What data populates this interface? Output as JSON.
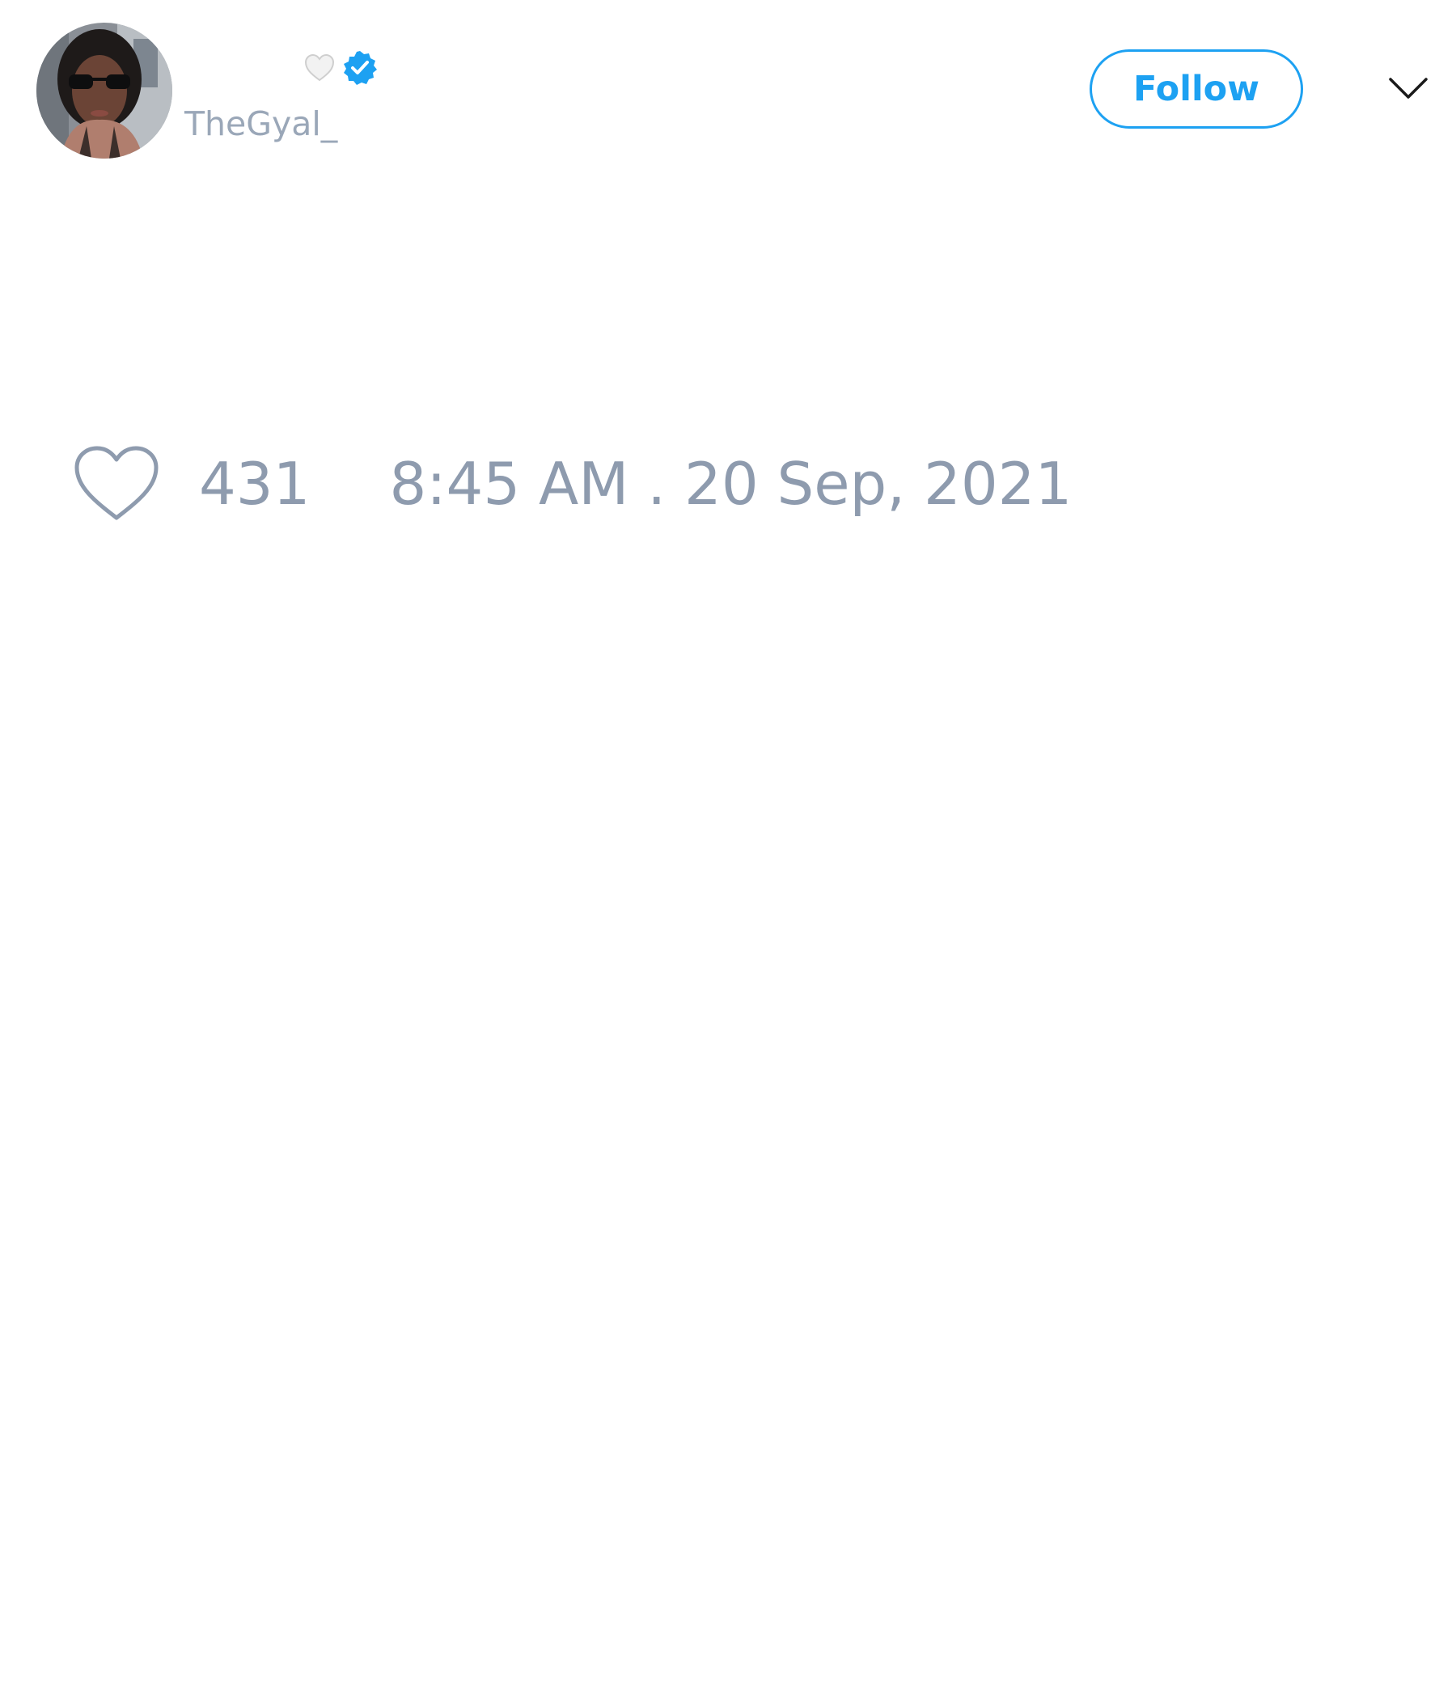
{
  "user": {
    "display_name_emoji": "🤍",
    "verified": true,
    "handle": "TheGyal_",
    "avatar": "user-avatar-photo"
  },
  "header": {
    "follow_label": "Follow",
    "menu_icon": "chevron-down-icon"
  },
  "tweet": {
    "like_icon": "heart-outline-icon",
    "like_count": "431",
    "timestamp": "8:45 AM . 20 Sep, 2021"
  },
  "colors": {
    "accent": "#1da1f2",
    "muted_text": "#8e9bae",
    "background": "#ffffff"
  }
}
